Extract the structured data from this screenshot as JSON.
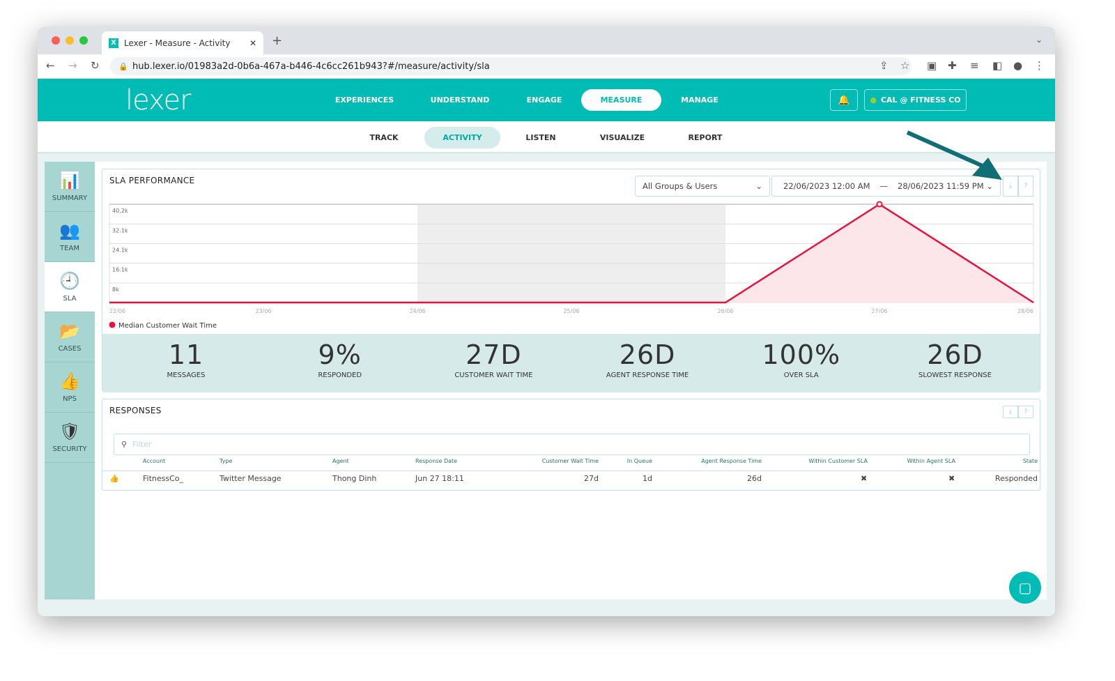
{
  "browser": {
    "tab_title": "Lexer - Measure - Activity",
    "url": "hub.lexer.io/01983a2d-0b6a-467a-b446-4c6cc261b943?#/measure/activity/sla"
  },
  "header": {
    "logo": "lexer",
    "nav": [
      "EXPERIENCES",
      "UNDERSTAND",
      "ENGAGE",
      "MEASURE",
      "MANAGE"
    ],
    "active_nav": "MEASURE",
    "account": "CAL @ FITNESS CO"
  },
  "subnav": {
    "items": [
      "TRACK",
      "ACTIVITY",
      "LISTEN",
      "VISUALIZE",
      "REPORT"
    ],
    "active": "ACTIVITY"
  },
  "sidebar": {
    "items": [
      {
        "label": "SUMMARY",
        "icon": "bar-chart-icon"
      },
      {
        "label": "TEAM",
        "icon": "users-icon"
      },
      {
        "label": "SLA",
        "icon": "clock-icon"
      },
      {
        "label": "CASES",
        "icon": "folder-icon"
      },
      {
        "label": "NPS",
        "icon": "thumbs-up-icon"
      },
      {
        "label": "SECURITY",
        "icon": "shield-icon"
      }
    ],
    "active": "SLA"
  },
  "sla": {
    "title": "SLA PERFORMANCE",
    "group_filter": "All Groups & Users",
    "date_from": "22/06/2023 12:00 AM",
    "date_sep": "—",
    "date_to": "28/06/2023 11:59 PM",
    "download": "⤓",
    "help": "?"
  },
  "chart_data": {
    "type": "area",
    "title": "SLA PERFORMANCE",
    "categories": [
      "22/06",
      "23/06",
      "24/06",
      "25/06",
      "26/06",
      "27/06",
      "28/06"
    ],
    "series": [
      {
        "name": "Median Customer Wait Time",
        "values": [
          0,
          0,
          0,
          0,
          0,
          40200,
          0
        ],
        "color": "#e8123c"
      }
    ],
    "y_ticks": [
      "8k",
      "16.1k",
      "24.1k",
      "32.1k",
      "40.2k"
    ],
    "ylim": [
      0,
      40200
    ],
    "highlight_range": [
      "24/06",
      "26/06"
    ],
    "legend": "bottom-left",
    "grid": true
  },
  "stats": [
    {
      "value": "11",
      "label": "MESSAGES"
    },
    {
      "value": "9%",
      "label": "RESPONDED"
    },
    {
      "value": "27D",
      "label": "CUSTOMER WAIT TIME"
    },
    {
      "value": "26D",
      "label": "AGENT RESPONSE TIME"
    },
    {
      "value": "100%",
      "label": "OVER SLA"
    },
    {
      "value": "26D",
      "label": "SLOWEST RESPONSE"
    }
  ],
  "responses": {
    "title": "RESPONSES",
    "filter_placeholder": "Filter",
    "columns": [
      "Account",
      "Type",
      "Agent",
      "Response Date",
      "Customer Wait Time",
      "In Queue",
      "Agent Response Time",
      "Within Customer SLA",
      "Within Agent SLA",
      "State"
    ],
    "rows": [
      {
        "account": "FitnessCo_",
        "type": "Twitter Message",
        "agent": "Thong Dinh",
        "date": "Jun 27 18:11",
        "wait": "27d",
        "queue": "1d",
        "agent_time": "26d",
        "within_customer": "✖",
        "within_agent": "✖",
        "state": "Responded"
      }
    ]
  }
}
